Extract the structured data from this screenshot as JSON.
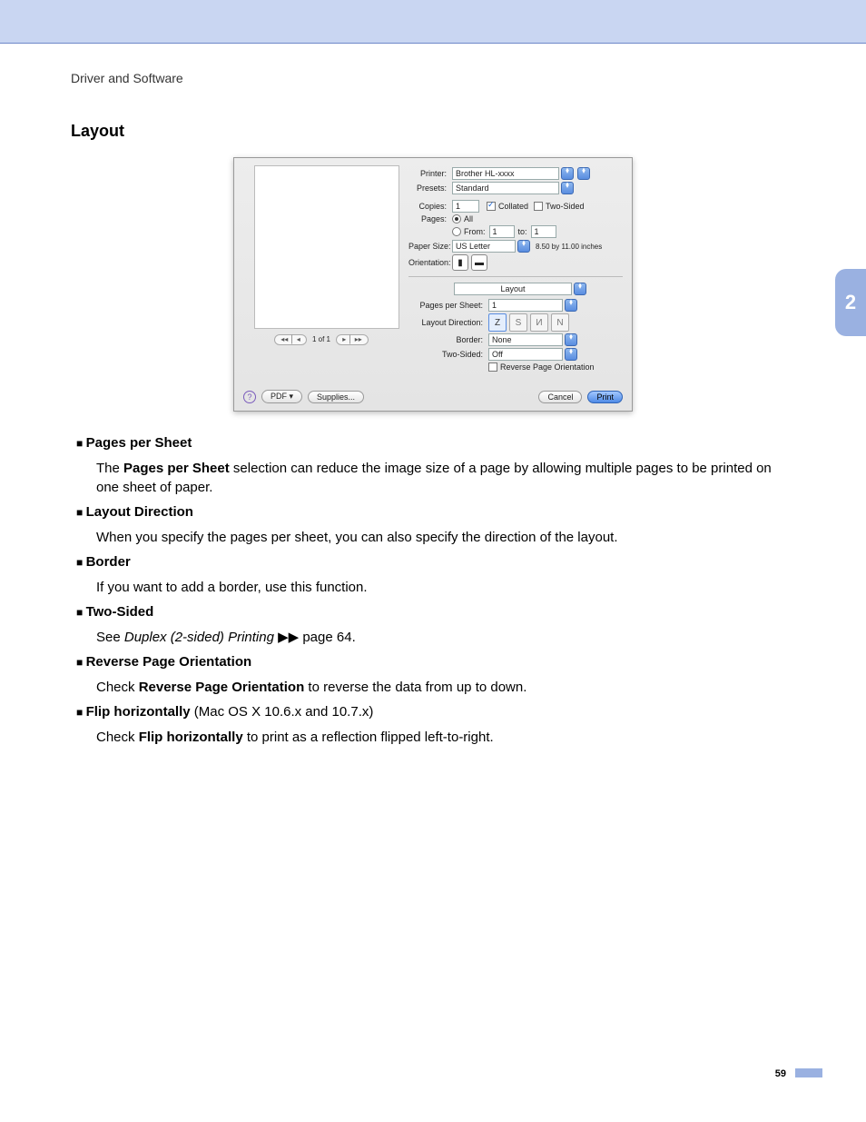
{
  "breadcrumb": "Driver and Software",
  "section_title": "Layout",
  "side_tab": "2",
  "page_number": "59",
  "dialog": {
    "printer_label": "Printer:",
    "printer_value": "Brother HL-xxxx",
    "presets_label": "Presets:",
    "presets_value": "Standard",
    "copies_label": "Copies:",
    "copies_value": "1",
    "collated_label": "Collated",
    "two_sided_cb_label": "Two-Sided",
    "pages_label": "Pages:",
    "pages_all": "All",
    "pages_from": "From:",
    "pages_from_value": "1",
    "pages_to": "to:",
    "pages_to_value": "1",
    "paper_size_label": "Paper Size:",
    "paper_size_value": "US Letter",
    "paper_size_dims": "8.50 by 11.00 inches",
    "orientation_label": "Orientation:",
    "section_dropdown": "Layout",
    "pps_label": "Pages per Sheet:",
    "pps_value": "1",
    "layout_dir_label": "Layout Direction:",
    "border_label": "Border:",
    "border_value": "None",
    "twosided_label": "Two-Sided:",
    "twosided_value": "Off",
    "reverse_label": "Reverse Page Orientation",
    "preview_nav": "1 of 1",
    "pdf_btn": "PDF ▾",
    "supplies_btn": "Supplies...",
    "cancel_btn": "Cancel",
    "print_btn": "Print"
  },
  "bullets": {
    "pps_title": "Pages per Sheet",
    "pps_body_a": "The ",
    "pps_body_b": "Pages per Sheet",
    "pps_body_c": " selection can reduce the image size of a page by allowing multiple pages to be printed on one sheet of paper.",
    "ld_title": "Layout Direction",
    "ld_body": "When you specify the pages per sheet, you can also specify the direction of the layout.",
    "border_title": "Border",
    "border_body": "If you want to add a border, use this function.",
    "ts_title": "Two-Sided",
    "ts_body_a": "See ",
    "ts_body_b": "Duplex (2-sided) Printing",
    "ts_body_c": " ▶▶ page 64.",
    "rpo_title": "Reverse Page Orientation",
    "rpo_body_a": "Check ",
    "rpo_body_b": "Reverse Page Orientation",
    "rpo_body_c": " to reverse the data from up to down.",
    "fh_title": "Flip horizontally",
    "fh_note": " (Mac OS X 10.6.x and 10.7.x)",
    "fh_body_a": "Check ",
    "fh_body_b": "Flip horizontally",
    "fh_body_c": " to print as a reflection flipped left-to-right."
  }
}
